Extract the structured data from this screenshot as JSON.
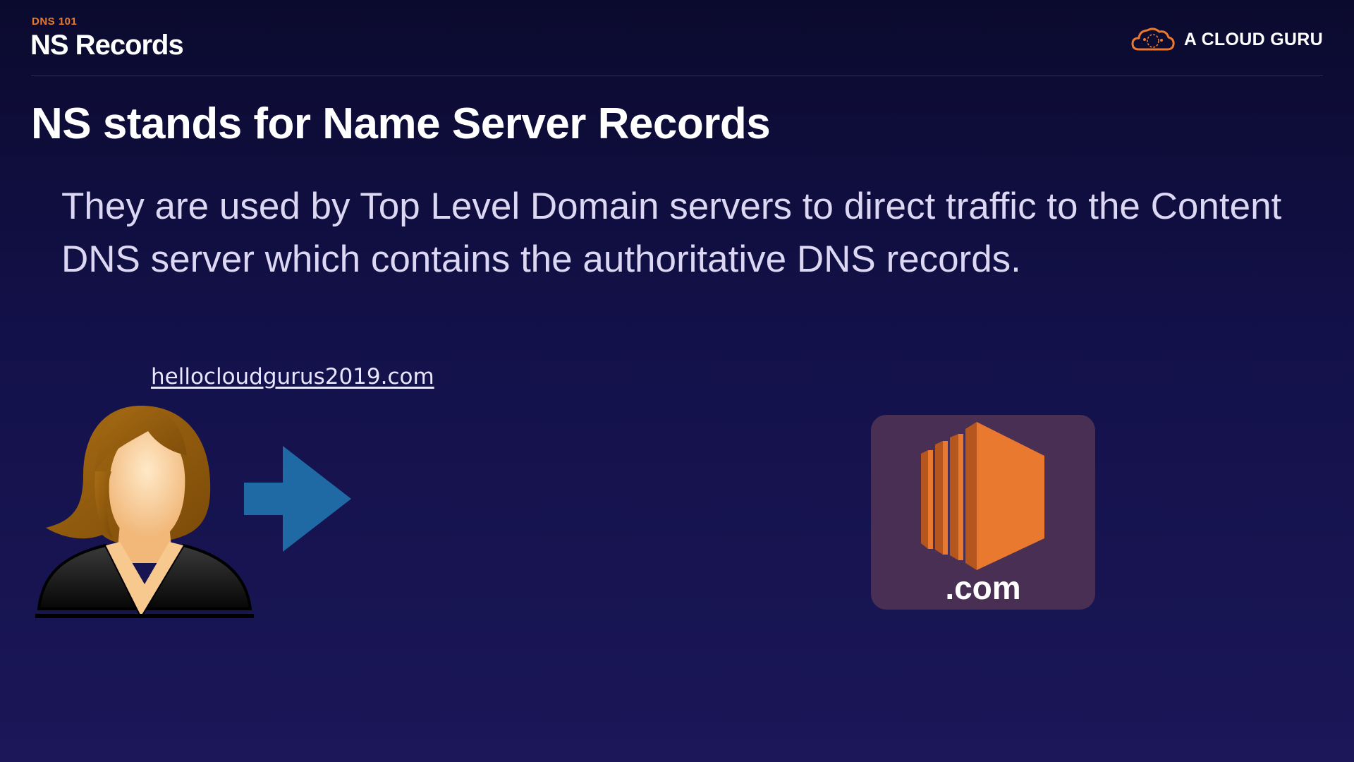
{
  "header": {
    "eyebrow": "DNS 101",
    "title": "NS Records"
  },
  "brand": {
    "name": "A CLOUD GURU",
    "icon": "cloud-icon",
    "accent_color": "#e8792f"
  },
  "slide": {
    "heading": "NS stands for Name Server Records",
    "body": "They are used by Top Level Domain servers to direct traffic to the Content DNS server which contains the authoritative DNS records."
  },
  "diagram": {
    "domain_link": "hellocloudgurus2019.com",
    "user_icon": "user-woman-icon",
    "arrow_icon": "arrow-right-icon",
    "arrow_color": "#1f6aa5",
    "server_icon": "server-icon",
    "server_color": "#e8792f",
    "tld_label": ".com"
  }
}
